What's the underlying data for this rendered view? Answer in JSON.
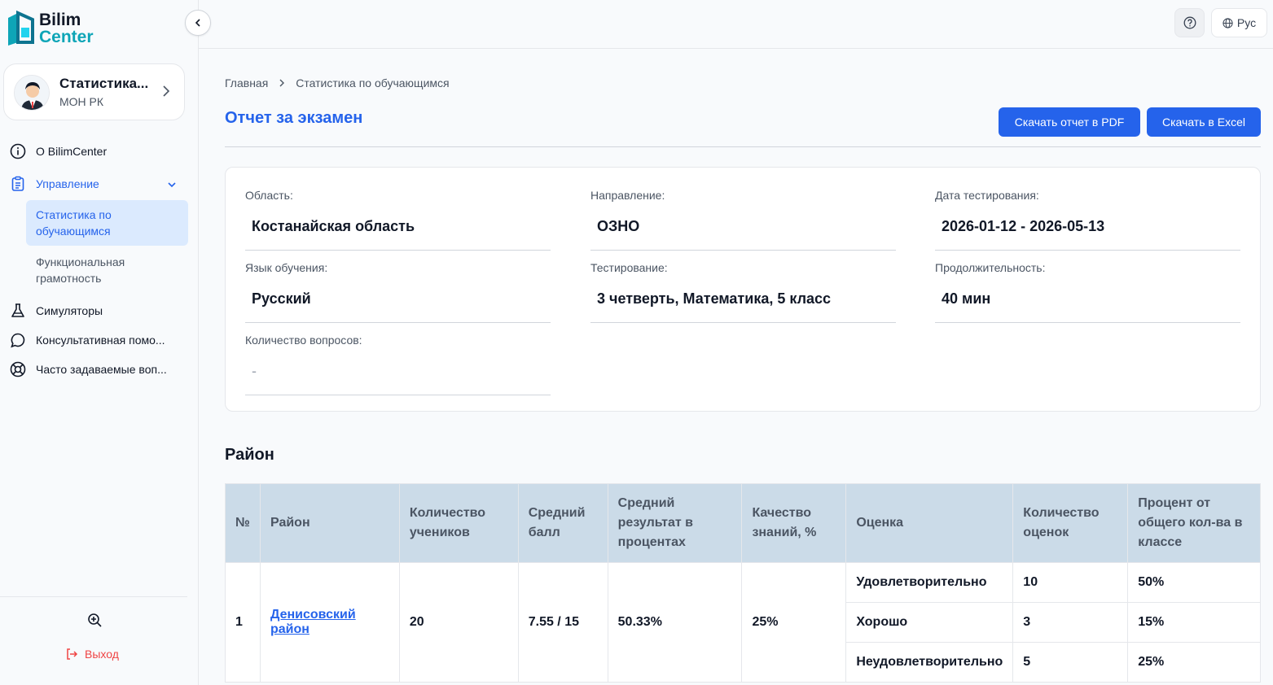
{
  "logo": {
    "line1": "Bilim",
    "line2": "Center"
  },
  "profile": {
    "name": "Статистика...",
    "org": "МОН РК"
  },
  "nav": {
    "about": "О BilimCenter",
    "management": "Управление",
    "sub_stats": "Статистика по обучающимся",
    "sub_literacy": "Функциональная грамотность",
    "simulators": "Симуляторы",
    "consult": "Консультативная помо...",
    "faq": "Часто задаваемые воп...",
    "logout": "Выход"
  },
  "topbar": {
    "lang": "Рус"
  },
  "breadcrumb": {
    "home": "Главная",
    "current": "Статистика по обучающимся"
  },
  "page": {
    "title": "Отчет за экзамен",
    "pdf_button": "Скачать отчет в PDF",
    "excel_button": "Скачать в Excel"
  },
  "filters": {
    "region_label": "Область:",
    "region": "Костанайская область",
    "direction_label": "Направление:",
    "direction": "ОЗНО",
    "date_label": "Дата тестирования:",
    "date": "2026-01-12 - 2026-05-13",
    "lang_label": "Язык обучения:",
    "lang": "Русский",
    "test_label": "Тестирование:",
    "test": "3 четверть, Математика, 5 класс",
    "duration_label": "Продолжительность:",
    "duration": "40 мин",
    "questions_label": "Количество вопросов:",
    "questions": "-"
  },
  "district": {
    "title": "Район",
    "columns": [
      "№",
      "Район",
      "Количество учеников",
      "Средний балл",
      "Средний результат в процентах",
      "Качество знаний, %",
      "Оценка",
      "Количество оценок",
      "Процент от общего кол-ва в классе"
    ],
    "row": {
      "num": "1",
      "name": "Денисовский район",
      "students": "20",
      "avg": "7.55 / 15",
      "avg_pct": "50.33%",
      "quality": "25%",
      "grades": [
        {
          "grade": "Удовлетворительно",
          "count": "10",
          "pct": "50%"
        },
        {
          "grade": "Хорошо",
          "count": "3",
          "pct": "15%"
        },
        {
          "grade": "Неудовлетворительно",
          "count": "5",
          "pct": "25%"
        }
      ]
    }
  }
}
